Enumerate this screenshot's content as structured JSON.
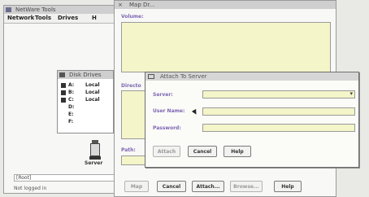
{
  "netware_tools": {
    "title": "NetWare Tools",
    "menu": [
      "Network",
      "Tools",
      "Drives",
      "H"
    ],
    "server_label": "Server",
    "status_field": "[Root]",
    "status_text": "Not logged in"
  },
  "drives_window": {
    "title": "Disk Drives",
    "drives": [
      {
        "letter": "A:",
        "value": "Local"
      },
      {
        "letter": "B:",
        "value": "Local"
      },
      {
        "letter": "C:",
        "value": "Local"
      },
      {
        "letter": "D:",
        "value": ""
      },
      {
        "letter": "E:",
        "value": ""
      },
      {
        "letter": "F:",
        "value": ""
      }
    ]
  },
  "map_window": {
    "title": "Map Dr...",
    "volume_label": "Volume:",
    "directory_label": "Directo",
    "path_label": "Path:",
    "buttons": [
      "Map",
      "Cancel",
      "Attach...",
      "Browse...",
      "Help"
    ]
  },
  "attach_dialog": {
    "title": "Attach To Server",
    "server_label": "Server:",
    "username_label": "User Name:",
    "password_label": "Password:",
    "buttons": [
      "Attach",
      "Cancel",
      "Help"
    ]
  }
}
